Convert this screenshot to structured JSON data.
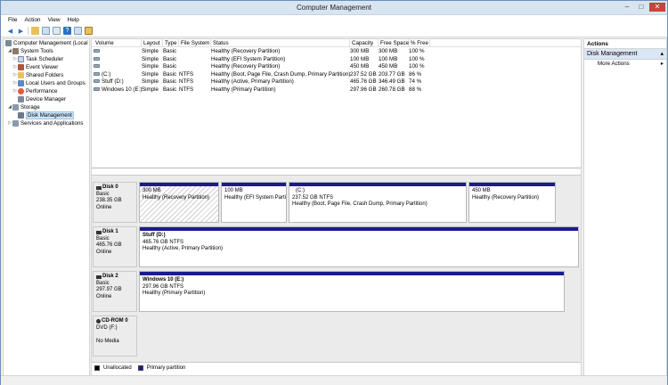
{
  "window": {
    "title": "Computer Management",
    "controls": [
      "–",
      "□",
      "✕"
    ]
  },
  "menu": [
    "File",
    "Action",
    "View",
    "Help"
  ],
  "tree": {
    "root": "Computer Management (Local",
    "system_tools": "System Tools",
    "task_scheduler": "Task Scheduler",
    "event_viewer": "Event Viewer",
    "shared_folders": "Shared Folders",
    "local_users": "Local Users and Groups",
    "performance": "Performance",
    "device_manager": "Device Manager",
    "storage": "Storage",
    "disk_management": "Disk Management",
    "services": "Services and Applications"
  },
  "volumes": {
    "headers": [
      "Volume",
      "Layout",
      "Type",
      "File System",
      "Status",
      "Capacity",
      "Free Space",
      "% Free"
    ],
    "rows": [
      [
        "",
        "Simple",
        "Basic",
        "",
        "Healthy (Recovery Partition)",
        "300 MB",
        "300 MB",
        "100 %"
      ],
      [
        "",
        "Simple",
        "Basic",
        "",
        "Healthy (EFI System Partition)",
        "100 MB",
        "100 MB",
        "100 %"
      ],
      [
        "",
        "Simple",
        "Basic",
        "",
        "Healthy (Recovery Partition)",
        "450 MB",
        "450 MB",
        "100 %"
      ],
      [
        "(C:)",
        "Simple",
        "Basic",
        "NTFS",
        "Healthy (Boot, Page File, Crash Dump, Primary Partition)",
        "237.52 GB",
        "203.77 GB",
        "86 %"
      ],
      [
        "Stuff (D:)",
        "Simple",
        "Basic",
        "NTFS",
        "Healthy (Active, Primary Partition)",
        "465.76 GB",
        "346.49 GB",
        "74 %"
      ],
      [
        "Windows 10 (E:)",
        "Simple",
        "Basic",
        "NTFS",
        "Healthy (Primary Partition)",
        "297.96 GB",
        "260.78 GB",
        "88 %"
      ]
    ]
  },
  "disks": {
    "disk0": {
      "name": "Disk 0",
      "type": "Basic",
      "size": "238.35 GB",
      "state": "Online",
      "p1": {
        "size": "300 MB",
        "status": "Healthy (Recovery Partition)"
      },
      "p2": {
        "size": "100 MB",
        "status": "Healthy (EFI System Partiti"
      },
      "p3": {
        "label": "(C:)",
        "size": "237.52 GB NTFS",
        "status": "Healthy (Boot, Page File, Crash Dump, Primary Partition)"
      },
      "p4": {
        "size": "450 MB",
        "status": "Healthy (Recovery Partition)"
      }
    },
    "disk1": {
      "name": "Disk 1",
      "type": "Basic",
      "size": "465.76 GB",
      "state": "Online",
      "p1": {
        "label": "Stuff  (D:)",
        "size": "465.76 GB NTFS",
        "status": "Healthy (Active, Primary Partition)"
      }
    },
    "disk2": {
      "name": "Disk 2",
      "type": "Basic",
      "size": "297.97 GB",
      "state": "Online",
      "p1": {
        "label": "Windows 10  (E:)",
        "size": "297.96 GB NTFS",
        "status": "Healthy (Primary Partition)"
      }
    },
    "cdrom0": {
      "name": "CD-ROM 0",
      "type": "DVD (F:)",
      "state": "No Media"
    }
  },
  "legend": {
    "unallocated": "Unallocated",
    "primary": "Primary partition"
  },
  "actions": {
    "header": "Actions",
    "section": "Disk Management",
    "more": "More Actions"
  },
  "colors": {
    "primary_partition": "#1b1b8f",
    "unallocated": "#000000",
    "selection": "#cce4f7"
  }
}
